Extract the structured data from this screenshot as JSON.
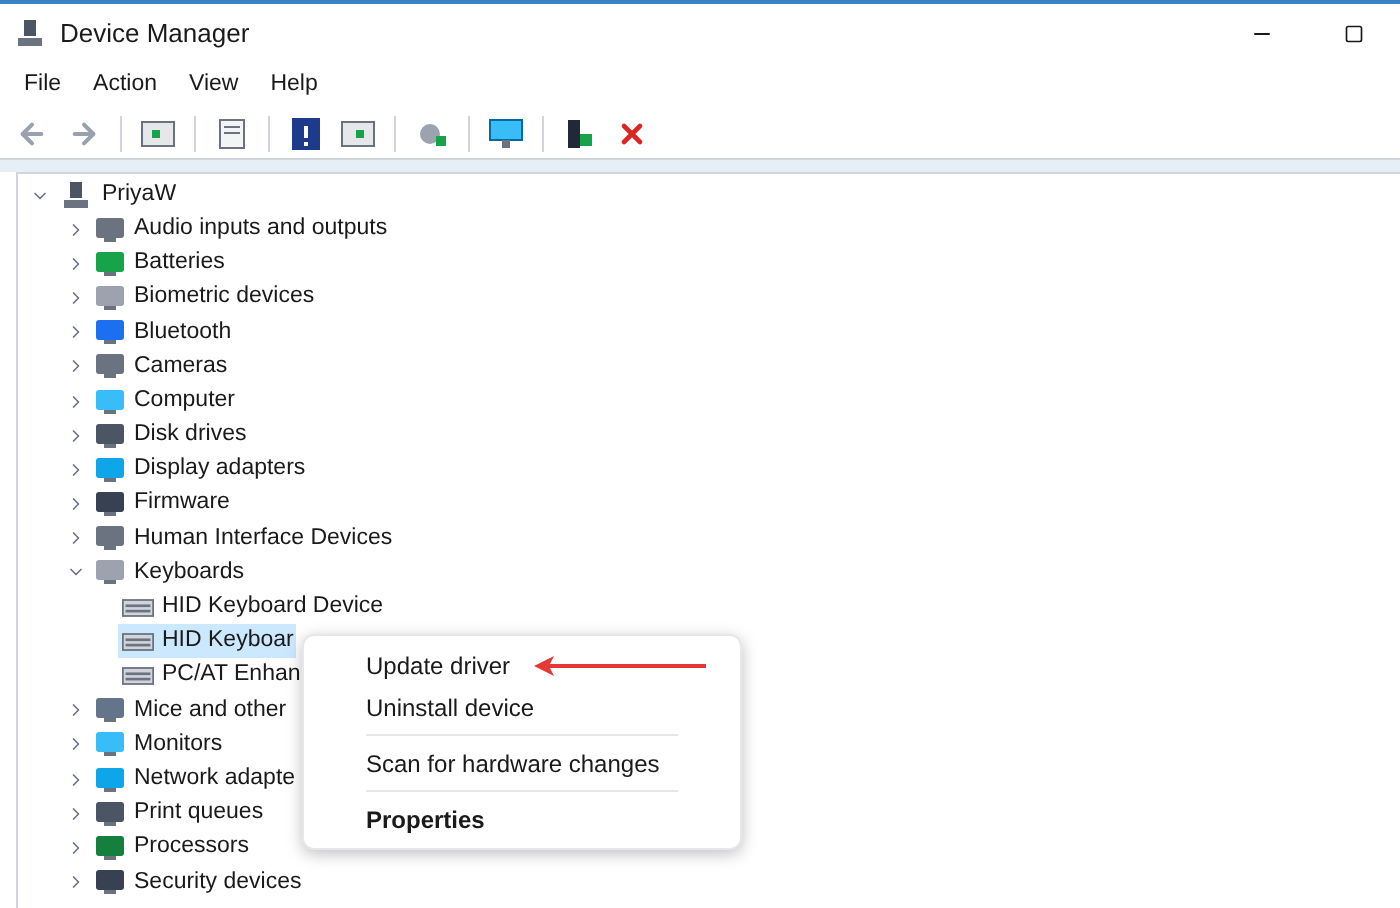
{
  "window": {
    "title": "Device Manager"
  },
  "menu_bar": [
    "File",
    "Action",
    "View",
    "Help"
  ],
  "tree": [
    {
      "label": "PriyaW",
      "expanded": true,
      "children": [
        {
          "label": "Audio inputs and outputs",
          "expanded": false
        },
        {
          "label": "Batteries",
          "expanded": false
        },
        {
          "label": "Biometric devices",
          "expanded": false
        },
        {
          "label": "Bluetooth",
          "expanded": false
        },
        {
          "label": "Cameras",
          "expanded": false
        },
        {
          "label": "Computer",
          "expanded": false
        },
        {
          "label": "Disk drives",
          "expanded": false
        },
        {
          "label": "Display adapters",
          "expanded": false
        },
        {
          "label": "Firmware",
          "expanded": false
        },
        {
          "label": "Human Interface Devices",
          "expanded": false
        },
        {
          "label": "Keyboards",
          "expanded": true,
          "children": [
            {
              "label": "HID Keyboard Device",
              "selected": false
            },
            {
              "label": "HID Keyboar",
              "selected": true
            },
            {
              "label": "PC/AT Enhan",
              "selected": false
            }
          ]
        },
        {
          "label": "Mice and other",
          "expanded": false
        },
        {
          "label": "Monitors",
          "expanded": false
        },
        {
          "label": "Network adapte",
          "expanded": false
        },
        {
          "label": "Print queues",
          "expanded": false
        },
        {
          "label": "Processors",
          "expanded": false
        },
        {
          "label": "Security devices",
          "expanded": false
        }
      ]
    }
  ],
  "context_menu": [
    {
      "label": "Update driver",
      "kind": "item"
    },
    {
      "label": "Uninstall device",
      "kind": "item"
    },
    {
      "kind": "separator"
    },
    {
      "label": "Scan for hardware changes",
      "kind": "item"
    },
    {
      "kind": "separator"
    },
    {
      "label": "Properties",
      "kind": "default"
    }
  ]
}
